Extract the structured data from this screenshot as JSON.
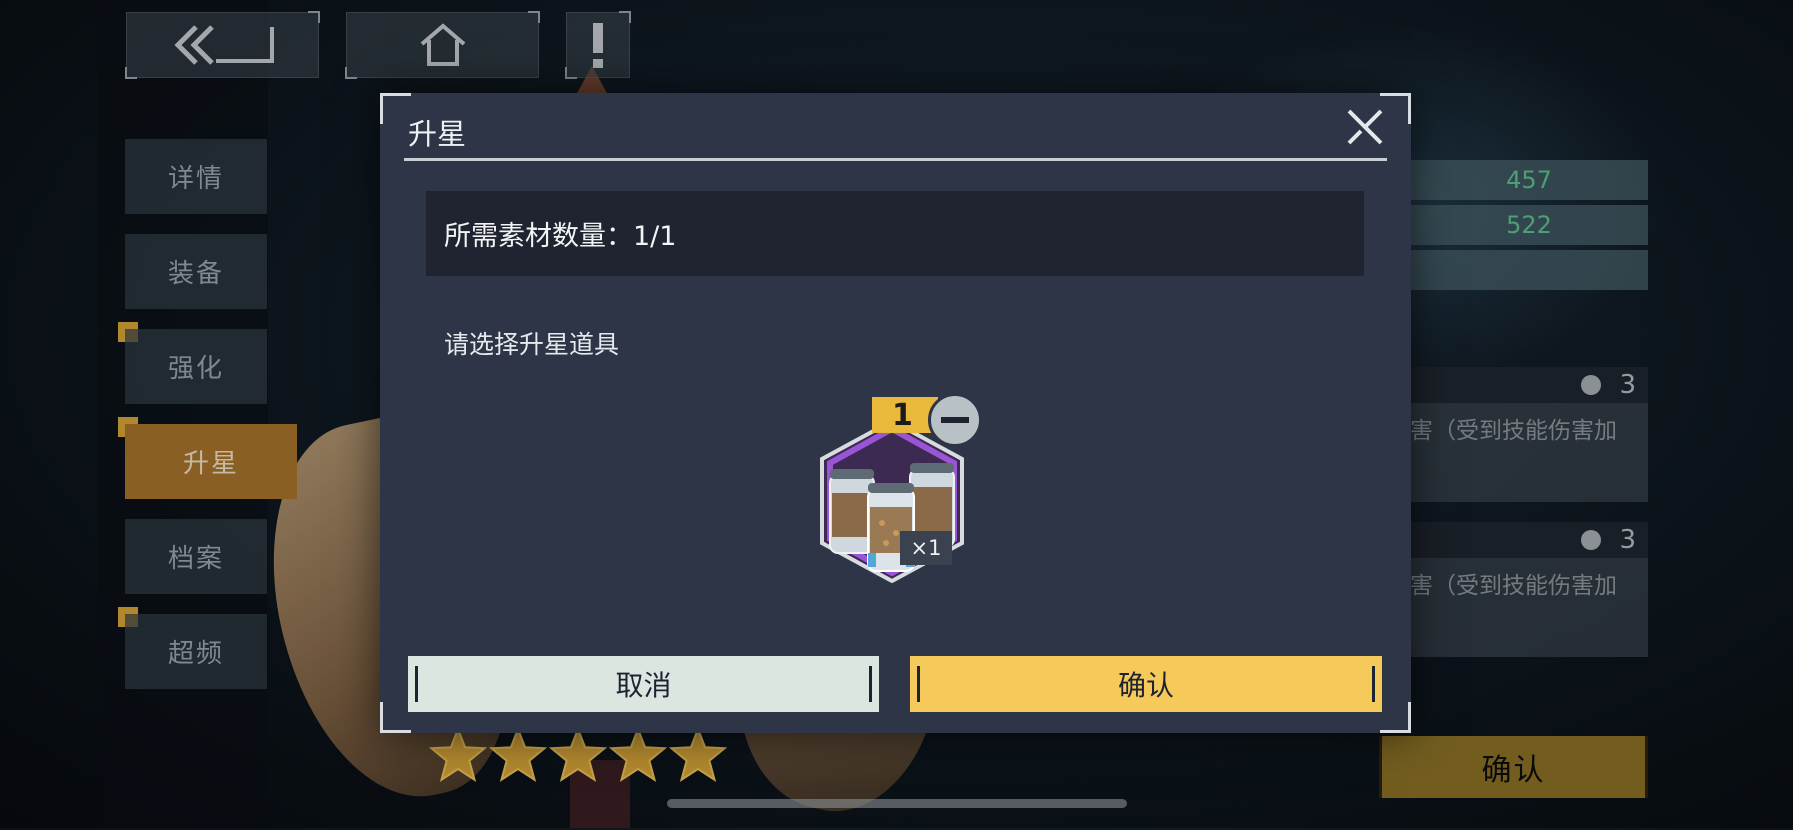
{
  "nav": {
    "back_icon": "double-chevron-back-icon",
    "home_icon": "home-icon",
    "info_icon": "exclamation-icon"
  },
  "sidebar": {
    "items": [
      {
        "label": "详情"
      },
      {
        "label": "装备"
      },
      {
        "label": "强化"
      },
      {
        "label": "升星"
      },
      {
        "label": "档案"
      },
      {
        "label": "超频"
      }
    ],
    "active_index": 3
  },
  "right_panel": {
    "stats": [
      "457",
      "522"
    ],
    "skills": [
      {
        "level": "3",
        "text": "害（受到技能伤害加"
      },
      {
        "level": "3",
        "text": "害（受到技能伤害加"
      }
    ],
    "confirm_label": "确认"
  },
  "character": {
    "stars": 5
  },
  "modal": {
    "title": "升星",
    "required_text": "所需素材数量：1/1",
    "prompt": "请选择升星道具",
    "item": {
      "count_badge": "1",
      "quantity": "×1",
      "icon": "material-canisters-icon"
    },
    "cancel_label": "取消",
    "confirm_label": "确认"
  },
  "colors": {
    "modal_bg": "#2d3546",
    "confirm_yellow": "#f5c95a",
    "cancel_mint": "#dbe6e1",
    "active_tab": "#a8742c",
    "stat_green": "#5fc38a"
  }
}
